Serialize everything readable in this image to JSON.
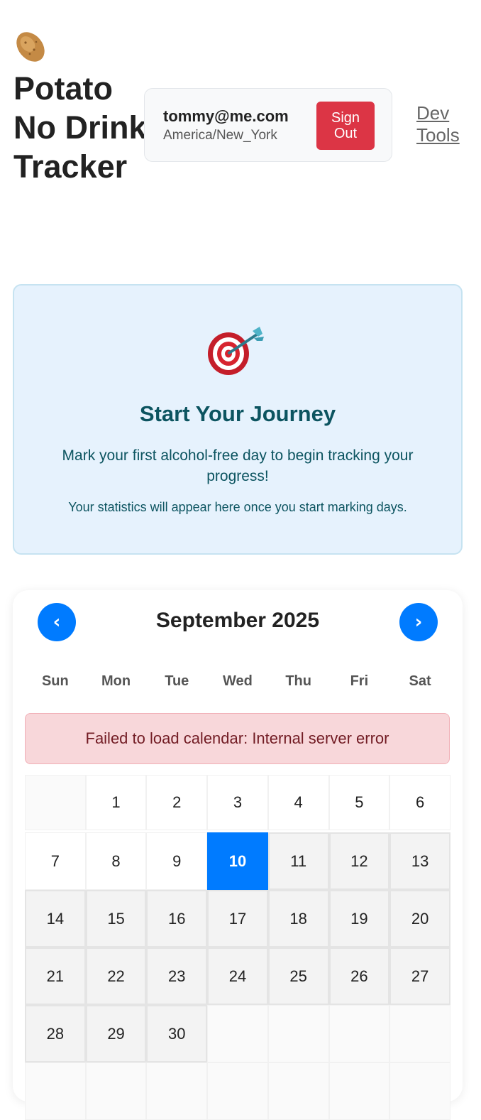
{
  "app": {
    "title": "Potato No Drink Tracker",
    "logo_icon": "potato-icon"
  },
  "user": {
    "email": "tommy@me.com",
    "timezone": "America/New_York",
    "sign_out_label": "Sign Out"
  },
  "dev_tools_label": "Dev Tools",
  "journey": {
    "icon": "target-icon",
    "title": "Start Your Journey",
    "text": "Mark your first alcohol-free day to begin tracking your progress!",
    "subtext": "Your statistics will appear here once you start marking days."
  },
  "calendar": {
    "month_label": "September 2025",
    "prev_label": "‹",
    "next_label": "›",
    "weekdays": [
      "Sun",
      "Mon",
      "Tue",
      "Wed",
      "Thu",
      "Fri",
      "Sat"
    ],
    "error": "Failed to load calendar: Internal server error",
    "leading_empty_days": 1,
    "days_in_month": 30,
    "today": 10,
    "trailing_empty_days": 11
  },
  "colors": {
    "primary": "#007bff",
    "danger": "#dc3545",
    "info_bg": "#e6f2fd",
    "info_text": "#0c5460",
    "error_bg": "#f8d7da",
    "error_text": "#721c24"
  }
}
